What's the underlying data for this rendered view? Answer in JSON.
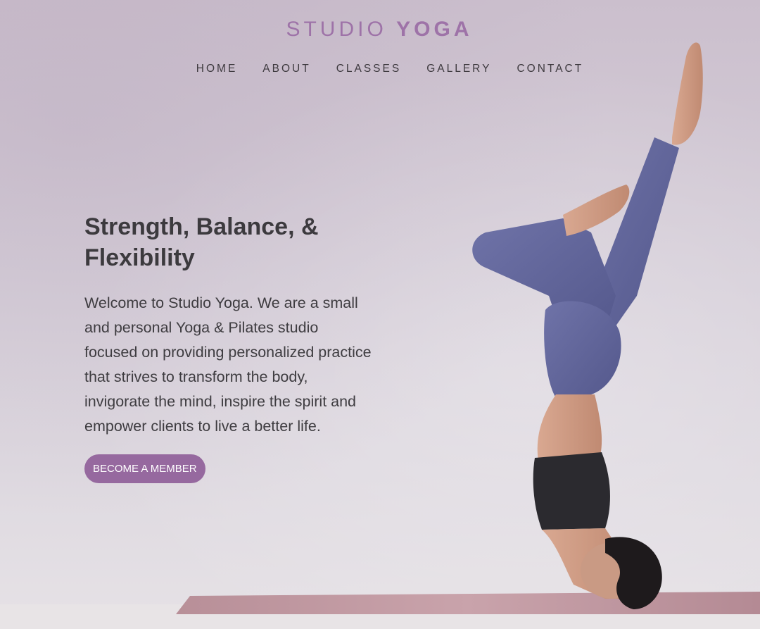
{
  "brand": {
    "name_light": "STUDIO",
    "name_bold": "YOGA",
    "color": "#9e73a8"
  },
  "nav": {
    "items": [
      {
        "label": "HOME"
      },
      {
        "label": "ABOUT"
      },
      {
        "label": "CLASSES"
      },
      {
        "label": "GALLERY"
      },
      {
        "label": "CONTACT"
      }
    ]
  },
  "hero": {
    "headline_line1": "Strength, Balance, &",
    "headline_line2": "Flexibility",
    "intro": "Welcome to Studio Yoga. We are a small and personal Yoga & Pilates studio focused on providing personalized practice that strives to transform the body, invigorate the mind, inspire the spirit and empower clients to live a better life.",
    "cta_label": "BECOME A MEMBER",
    "cta_color": "#96699f"
  },
  "photo": {
    "subject": "woman in headstand yoga pose on mat"
  }
}
